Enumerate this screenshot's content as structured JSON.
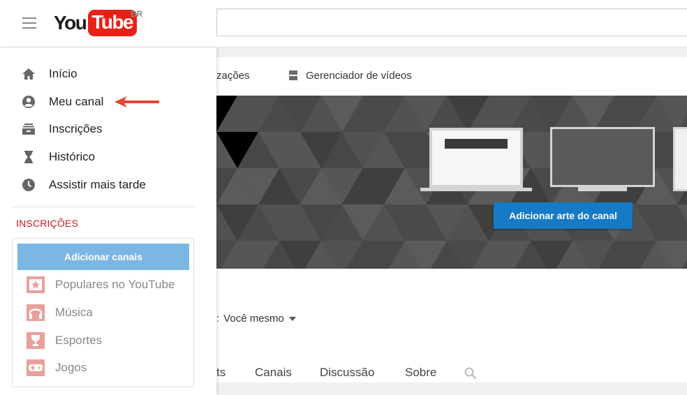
{
  "header": {
    "logo_you": "You",
    "logo_tube": "Tube",
    "region": "BR",
    "search": {
      "value": "",
      "placeholder": ""
    }
  },
  "sidebar": {
    "nav_items": [
      {
        "label": "Início",
        "icon": "home-icon"
      },
      {
        "label": "Meu canal",
        "icon": "account-icon"
      },
      {
        "label": "Inscrições",
        "icon": "subscriptions-icon"
      },
      {
        "label": "Histórico",
        "icon": "hourglass-icon"
      },
      {
        "label": "Assistir mais tarde",
        "icon": "clock-icon"
      }
    ],
    "annotation_arrow_color": "#e8452c",
    "subscriptions_title": "INSCRIÇÕES",
    "add_channels_label": "Adicionar canais",
    "subscription_items": [
      {
        "label": "Populares no YouTube",
        "icon": "popular-icon"
      },
      {
        "label": "Música",
        "icon": "headphones-icon"
      },
      {
        "label": "Esportes",
        "icon": "trophy-icon"
      },
      {
        "label": "Jogos",
        "icon": "gamepad-icon"
      }
    ]
  },
  "main": {
    "tab_partial": "zações",
    "tab_video_manager": "Gerenciador de vídeos",
    "add_channel_art_label": "Adicionar arte do canal",
    "view_as_prefix": ":",
    "view_as_value": "Você mesmo",
    "channel_tabs": [
      "ts",
      "Canais",
      "Discussão",
      "Sobre"
    ]
  },
  "colors": {
    "brand_red": "#e62117",
    "section_red": "#cc181e",
    "primary_blue": "#167ac6",
    "light_blue": "#7cb7e3",
    "icon_pink": "#e9a09a"
  }
}
